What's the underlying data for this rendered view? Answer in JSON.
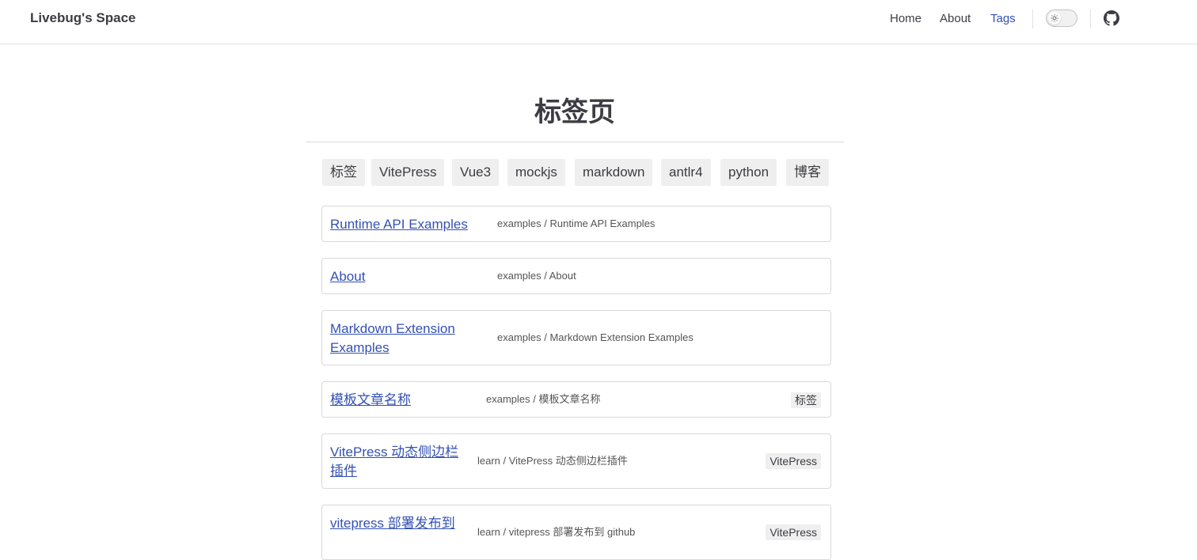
{
  "header": {
    "site_title": "Livebug's Space",
    "nav": [
      "Home",
      "About",
      "Tags"
    ],
    "active_nav": "Tags",
    "theme_icon": "sun-icon",
    "repo_icon": "github-icon"
  },
  "main": {
    "title": "标签页",
    "tags": [
      "标签",
      "VitePress",
      "Vue3",
      "mockjs",
      "markdown",
      "antlr4",
      "python",
      "博客"
    ],
    "articles": [
      {
        "title": "Runtime API Examples",
        "path": "examples / Runtime API Examples",
        "tag": ""
      },
      {
        "title": "About",
        "path": "examples / About",
        "tag": ""
      },
      {
        "title": "Markdown Extension Examples",
        "path": "examples / Markdown Extension Examples",
        "tag": ""
      },
      {
        "title": "模板文章名称",
        "path": "examples / 模板文章名称",
        "tag": "标签"
      },
      {
        "title": "VitePress 动态侧边栏插件",
        "path": "learn / VitePress 动态侧边栏插件",
        "tag": "VitePress"
      },
      {
        "title": "vitepress 部署发布到",
        "path": "learn / vitepress 部署发布到 github",
        "tag": "VitePress"
      }
    ]
  },
  "colors": {
    "accent": "#3451b2",
    "chip_bg": "#efefef",
    "border": "#d9d9dc"
  }
}
